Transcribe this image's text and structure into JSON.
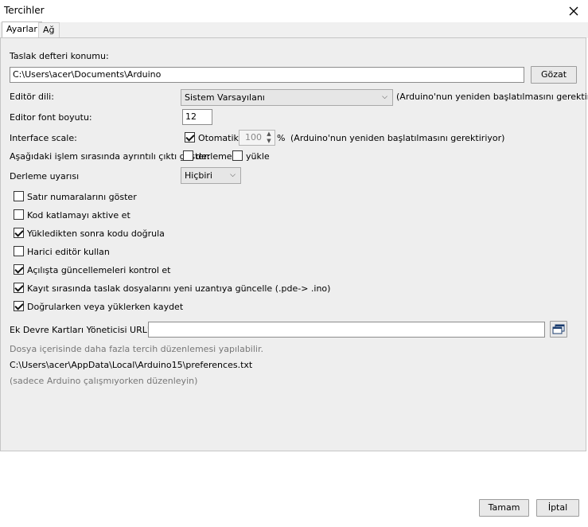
{
  "window": {
    "title": "Tercihler"
  },
  "tabs": [
    {
      "label": "Ayarlar",
      "active": true
    },
    {
      "label": "Ağ",
      "active": false
    }
  ],
  "sketchbook": {
    "label": "Taslak defteri konumu:",
    "value": "C:\\Users\\acer\\Documents\\Arduino",
    "browse_label": "Gözat"
  },
  "editor_language": {
    "label": "Editör dili:",
    "value": "Sistem Varsayılanı",
    "note": "(Arduino'nun yeniden başlatılmasını gerektiriyor)"
  },
  "font_size": {
    "label": "Editor font boyutu:",
    "value": "12"
  },
  "interface_scale": {
    "label": "Interface scale:",
    "auto_label": "Otomatik",
    "auto_checked": true,
    "value": "100",
    "unit": "%",
    "note": "(Arduino'nun yeniden başlatılmasını gerektiriyor)"
  },
  "verbose": {
    "label": "Aşağıdaki işlem sırasında ayrıntılı çıktı göster:",
    "compile_label": "derleme",
    "compile_checked": false,
    "upload_label": "yükle",
    "upload_checked": false
  },
  "compiler_warnings": {
    "label": "Derleme uyarısı",
    "value": "Hiçbiri"
  },
  "options": [
    {
      "label": "Satır numaralarını göster",
      "checked": false
    },
    {
      "label": "Kod katlamayı aktive et",
      "checked": false
    },
    {
      "label": "Yükledikten sonra kodu doğrula",
      "checked": true
    },
    {
      "label": "Harici editör kullan",
      "checked": false
    },
    {
      "label": "Açılışta güncellemeleri kontrol et",
      "checked": true
    },
    {
      "label": "Kayıt sırasında taslak dosyalarını yeni uzantıya güncelle (.pde-> .ino)",
      "checked": true
    },
    {
      "label": "Doğrularken veya yüklerken kaydet",
      "checked": true
    }
  ],
  "boards_url": {
    "label": "Ek Devre Kartları Yöneticisi URL'leri:",
    "value": ""
  },
  "info": {
    "more_prefs": "Dosya içerisinde daha fazla tercih düzenlemesi yapılabilir.",
    "prefs_path": "C:\\Users\\acer\\AppData\\Local\\Arduino15\\preferences.txt",
    "edit_note": "(sadece Arduino çalışmıyorken düzenleyin)"
  },
  "buttons": {
    "ok_label": "Tamam",
    "cancel_label": "İptal"
  },
  "icons": {
    "close": "close-icon",
    "window_edit": "window-edit-icon",
    "dropdown": "chevron-down-icon"
  }
}
